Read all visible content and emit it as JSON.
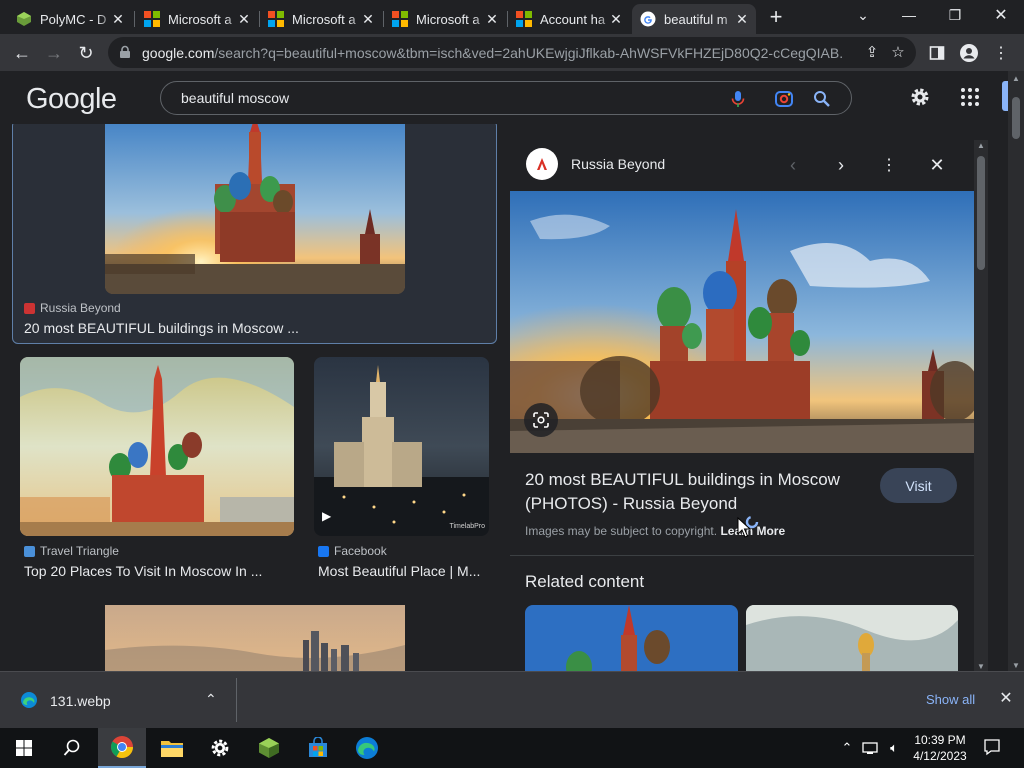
{
  "browser": {
    "tabs": [
      {
        "title": "PolyMC - D",
        "icon": "polymc-icon"
      },
      {
        "title": "Microsoft a",
        "icon": "microsoft-icon"
      },
      {
        "title": "Microsoft a",
        "icon": "microsoft-icon"
      },
      {
        "title": "Microsoft a",
        "icon": "microsoft-icon"
      },
      {
        "title": "Account ha",
        "icon": "microsoft-icon"
      },
      {
        "title": "beautiful m",
        "icon": "google-icon",
        "active": true
      }
    ],
    "url_host": "google.com",
    "url_rest": "/search?q=beautiful+moscow&tbm=isch&ved=2ahUKEwjgiJflkab-AhWSFVkFHZEjD80Q2-cCegQIAB..."
  },
  "google": {
    "logo": "Google",
    "query": "beautiful moscow"
  },
  "results": [
    {
      "source": "Russia Beyond",
      "title": "20 most BEAUTIFUL buildings in Moscow ..."
    },
    {
      "source": "Travel Triangle",
      "title": "Top 20 Places To Visit In Moscow In ..."
    },
    {
      "source": "Facebook",
      "title": "Most Beautiful Place | M...",
      "watermark": "TimelabPro"
    }
  ],
  "panel": {
    "source": "Russia Beyond",
    "title": "20 most BEAUTIFUL buildings in Moscow (PHOTOS) - Russia Beyond",
    "visit": "Visit",
    "copyright": "Images may be subject to copyright.",
    "learn_more": "Learn More",
    "related": "Related content"
  },
  "download": {
    "file": "131.webp",
    "show_all": "Show all"
  },
  "taskbar": {
    "time": "10:39 PM",
    "date": "4/12/2023"
  },
  "colors": {
    "accent": "#8ab4f8",
    "background": "#202124",
    "toolbar": "#35363a"
  }
}
